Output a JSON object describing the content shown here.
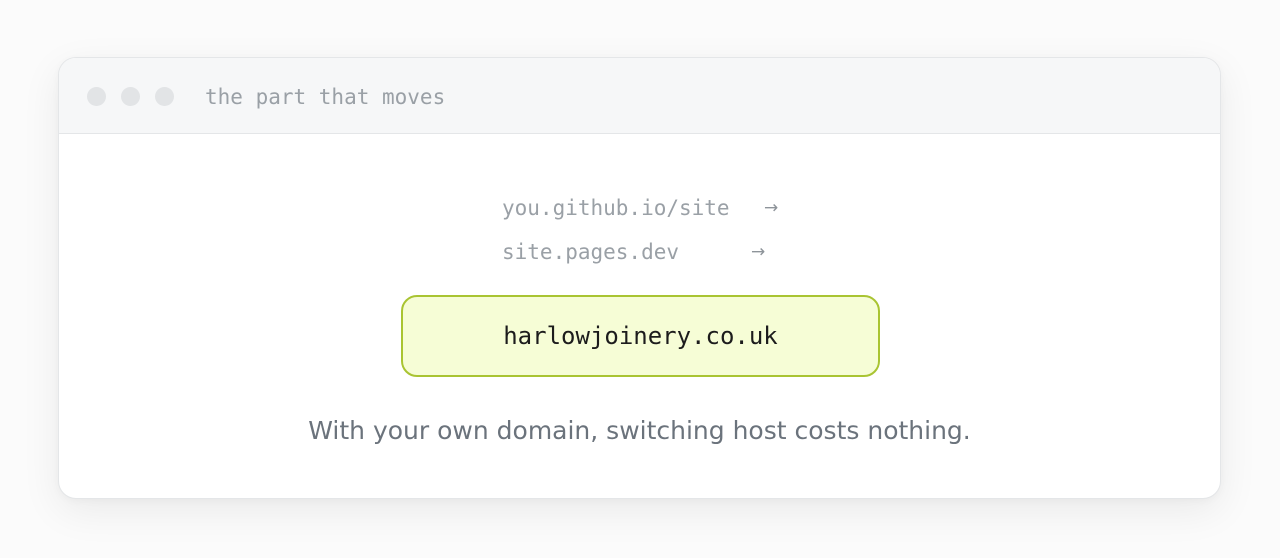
{
  "window": {
    "title": "the part that moves"
  },
  "hosts": [
    {
      "url": "you.github.io/site",
      "arrow": "→"
    },
    {
      "url": "site.pages.dev",
      "arrow": "→"
    }
  ],
  "domain": {
    "name": "harlowjoinery.co.uk"
  },
  "caption": "With your own domain, switching host costs nothing.",
  "colors": {
    "domain_fill": "#f6fdd6",
    "domain_border": "#a9c432",
    "muted_text": "#9aa0a6",
    "caption_text": "#6b737c"
  }
}
